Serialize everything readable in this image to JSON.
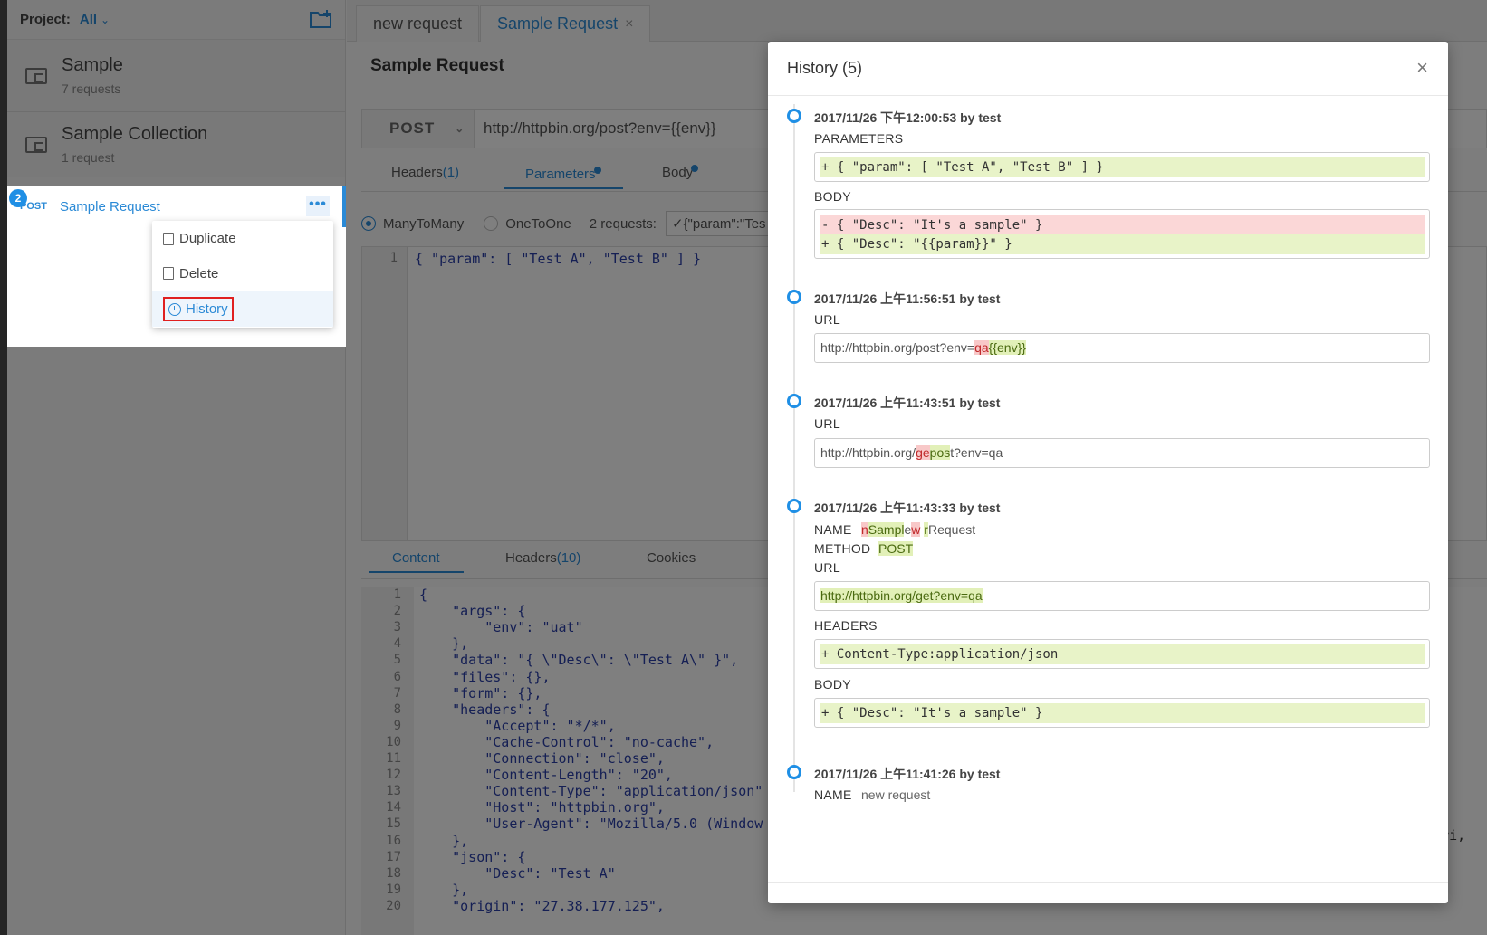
{
  "sidebar": {
    "project_label": "Project:",
    "project_value": "All",
    "collections": [
      {
        "name": "Sample",
        "count": "7 requests"
      },
      {
        "name": "Sample Collection",
        "count": "1 request"
      }
    ],
    "request": {
      "badge": "2",
      "method": "POST",
      "name": "Sample Request",
      "more": "•••"
    },
    "context_menu": {
      "duplicate": "Duplicate",
      "delete": "Delete",
      "history": "History"
    }
  },
  "tabs": [
    {
      "label": "new request"
    },
    {
      "label": "Sample Request",
      "close": "×"
    }
  ],
  "request_title": "Sample Request",
  "method": "POST",
  "url": "http://httpbin.org/post?env={{env}}",
  "subtabs": {
    "headers": "Headers",
    "headers_count": "(1)",
    "parameters": "Parameters",
    "body": "Body"
  },
  "param_mode": {
    "many": "ManyToMany",
    "one": "OneToOne",
    "requests": "2 requests:",
    "preview": "✓{\"param\":\"Tes"
  },
  "editor": {
    "line": "1",
    "code": "{ \"param\": [ \"Test A\", \"Test B\" ] }"
  },
  "response_tabs": {
    "content": "Content",
    "headers": "Headers",
    "headers_count": "(10)",
    "cookies": "Cookies"
  },
  "response_lines": [
    {
      "n": "1",
      "t": "{"
    },
    {
      "n": "2",
      "t": "    \"args\": {"
    },
    {
      "n": "3",
      "t": "        \"env\": \"uat\""
    },
    {
      "n": "4",
      "t": "    },"
    },
    {
      "n": "5",
      "t": "    \"data\": \"{ \\\"Desc\\\": \\\"Test A\\\" }\","
    },
    {
      "n": "6",
      "t": "    \"files\": {},"
    },
    {
      "n": "7",
      "t": "    \"form\": {},"
    },
    {
      "n": "8",
      "t": "    \"headers\": {"
    },
    {
      "n": "9",
      "t": "        \"Accept\": \"*/*\","
    },
    {
      "n": "10",
      "t": "        \"Cache-Control\": \"no-cache\","
    },
    {
      "n": "11",
      "t": "        \"Connection\": \"close\","
    },
    {
      "n": "12",
      "t": "        \"Content-Length\": \"20\","
    },
    {
      "n": "13",
      "t": "        \"Content-Type\": \"application/json\""
    },
    {
      "n": "14",
      "t": "        \"Host\": \"httpbin.org\","
    },
    {
      "n": "15",
      "t": "        \"User-Agent\": \"Mozilla/5.0 (Window"
    },
    {
      "n": "16",
      "t": "    },"
    },
    {
      "n": "17",
      "t": "    \"json\": {"
    },
    {
      "n": "18",
      "t": "        \"Desc\": \"Test A\""
    },
    {
      "n": "19",
      "t": "    },"
    },
    {
      "n": "20",
      "t": "    \"origin\": \"27.38.177.125\","
    }
  ],
  "response_right_fragment": "afari,",
  "history": {
    "title": "History (5)",
    "close": "×",
    "entries": [
      {
        "head": "2017/11/26 下午12:00:53 by test",
        "params_label": "PARAMETERS",
        "params_add": "+ { \"param\": [ \"Test A\", \"Test B\" ] }",
        "body_label": "BODY",
        "body_del": "- { \"Desc\": \"It's a sample\" }",
        "body_add": "+ { \"Desc\": \"{{param}}\" }"
      },
      {
        "head": "2017/11/26 上午11:56:51 by test",
        "url_label": "URL",
        "url_prefix": "http://httpbin.org/post?env=",
        "url_del": "qa",
        "url_add": "{{env}}"
      },
      {
        "head": "2017/11/26 上午11:43:51 by test",
        "url_label": "URL",
        "url_prefix": "http://httpbin.org/",
        "url_del": "ge",
        "url_add": "pos",
        "url_suffix": "t?env=qa"
      },
      {
        "head": "2017/11/26 上午11:43:33 by test",
        "name_label": "NAME",
        "name_parts": [
          {
            "t": "n",
            "k": "del"
          },
          {
            "t": "Sampl",
            "k": "add"
          },
          {
            "t": "e",
            "k": "plain"
          },
          {
            "t": "w",
            "k": "del"
          },
          {
            "t": " ",
            "k": "plain"
          },
          {
            "t": "r",
            "k": "add"
          },
          {
            "t": "Request",
            "k": "plain"
          }
        ],
        "method_label": "METHOD",
        "method_add": "POST",
        "url_label": "URL",
        "url_add": "http://httpbin.org/get?env=qa",
        "headers_label": "HEADERS",
        "headers_add": "+ Content-Type:application/json",
        "body_label": "BODY",
        "body_add": "+ { \"Desc\": \"It's a sample\" }"
      },
      {
        "head": "2017/11/26 上午11:41:26 by test",
        "name_label": "NAME",
        "name_value": "new request"
      }
    ]
  }
}
